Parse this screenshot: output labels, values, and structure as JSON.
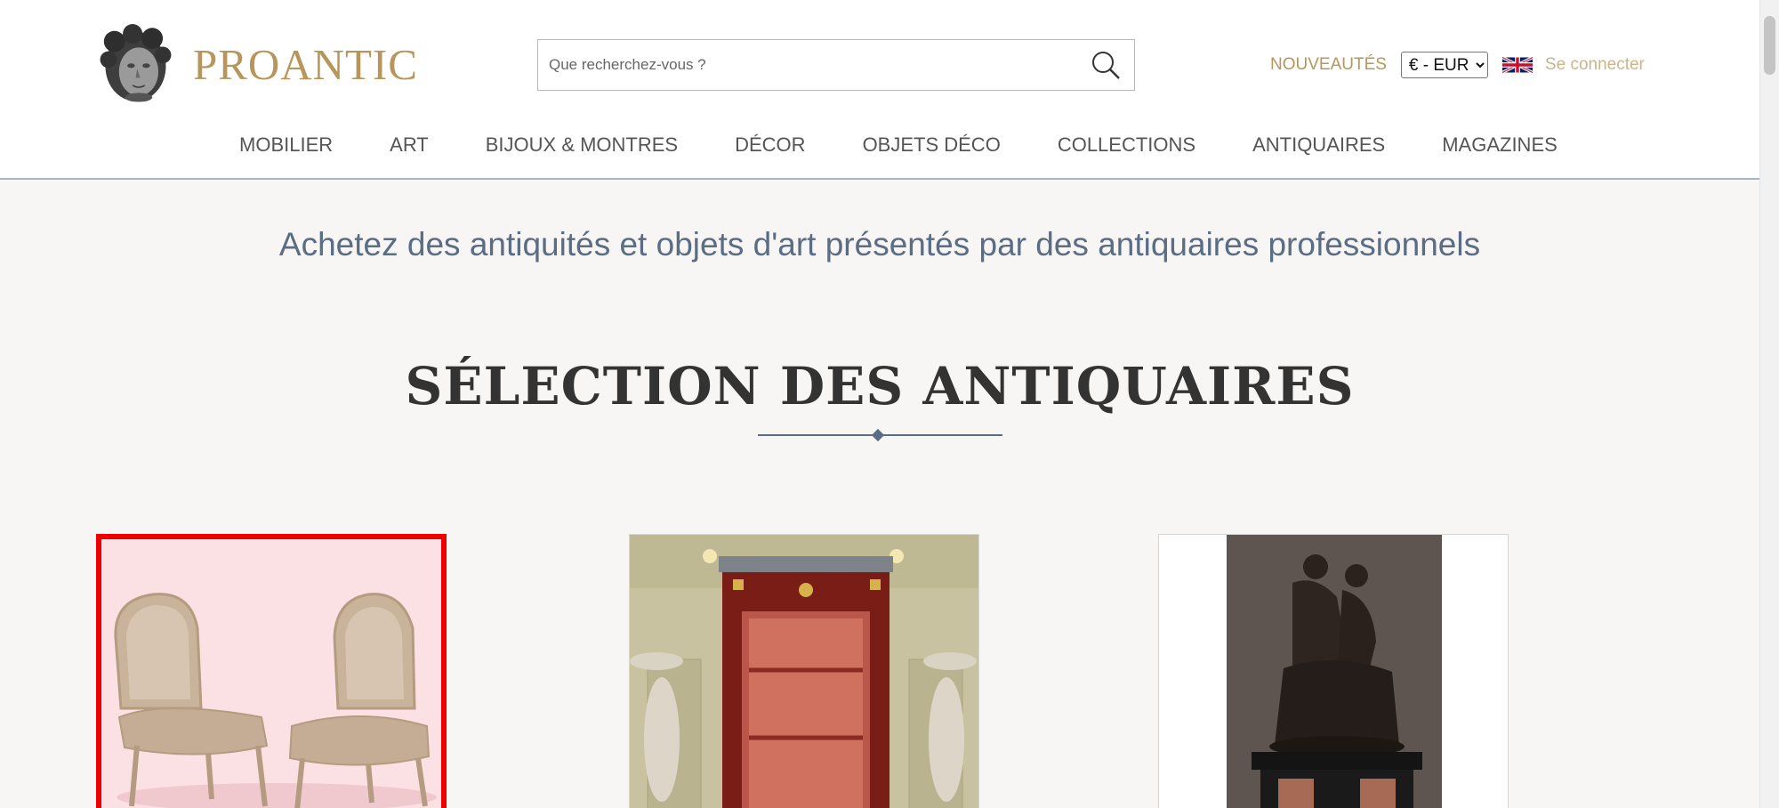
{
  "brand": {
    "name": "PROANTIC",
    "logo_icon": "cherub-head-icon"
  },
  "search": {
    "placeholder": "Que recherchez-vous ?",
    "icon": "search-icon"
  },
  "top_links": {
    "new_label": "NOUVEAUTÉS",
    "currency_selected": "€ - EUR",
    "language_icon": "uk-flag-icon",
    "login_label": "Se connecter"
  },
  "nav": {
    "items": [
      {
        "label": "MOBILIER"
      },
      {
        "label": "ART"
      },
      {
        "label": "BIJOUX & MONTRES"
      },
      {
        "label": "DÉCOR"
      },
      {
        "label": "OBJETS DÉCO"
      },
      {
        "label": "COLLECTIONS"
      },
      {
        "label": "ANTIQUAIRES"
      },
      {
        "label": "MAGAZINES"
      }
    ]
  },
  "tagline": "Achetez des antiquités et objets d'art présentés par des antiquaires professionnels",
  "selection": {
    "title": "SÉLECTION DES ANTIQUAIRES",
    "cards": [
      {
        "image": "pair-of-upholstered-chairs"
      },
      {
        "image": "mahogany-display-cabinet"
      },
      {
        "image": "bronze-sculpture-on-pedestal"
      }
    ]
  },
  "colors": {
    "brand_gold": "#b8965b",
    "login_gold": "#cbb48b",
    "tagline_blue": "#5a6d85",
    "selected_border": "#ee0000",
    "background": "#f7f6f4"
  }
}
